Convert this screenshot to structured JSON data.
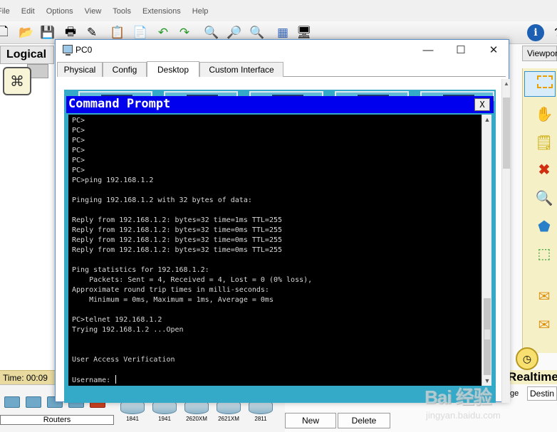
{
  "menu": [
    "File",
    "Edit",
    "Options",
    "View",
    "Tools",
    "Extensions",
    "Help"
  ],
  "workspace": {
    "logical_tab": "Logical",
    "viewport_tab": "Viewpor",
    "time_label": "Time: 00:09",
    "realtime_label": "Realtime",
    "destination_tab": "Destin",
    "destination_prefix": "ge"
  },
  "device_panel": {
    "category_label": "Routers",
    "models": [
      "1841",
      "1941",
      "2620XM",
      "2621XM",
      "2811"
    ]
  },
  "pdu_buttons": {
    "new": "New",
    "delete": "Delete"
  },
  "dialog": {
    "title": "PC0",
    "tabs": [
      "Physical",
      "Config",
      "Desktop",
      "Custom Interface"
    ],
    "active_tab": "Desktop"
  },
  "command_prompt": {
    "title": "Command Prompt",
    "close_label": "X",
    "output": "PC>\nPC>\nPC>\nPC>\nPC>\nPC>\nPC>ping 192.168.1.2\n\nPinging 192.168.1.2 with 32 bytes of data:\n\nReply from 192.168.1.2: bytes=32 time=1ms TTL=255\nReply from 192.168.1.2: bytes=32 time=0ms TTL=255\nReply from 192.168.1.2: bytes=32 time=0ms TTL=255\nReply from 192.168.1.2: bytes=32 time=0ms TTL=255\n\nPing statistics for 192.168.1.2:\n    Packets: Sent = 4, Received = 4, Lost = 0 (0% loss),\nApproximate round trip times in milli-seconds:\n    Minimum = 0ms, Maximum = 1ms, Average = 0ms\n\nPC>telnet 192.168.1.2\nTrying 192.168.1.2 ...Open\n\n\nUser Access Verification\n\n",
    "prompt_line": "Username: "
  },
  "watermark": {
    "main": "Bai 经验",
    "sub": "jingyan.baidu.com"
  },
  "colors": {
    "cmd_titlebar": "#0000ee",
    "terminal_bg": "#000000",
    "desktop_bg": "#35a9c8"
  }
}
